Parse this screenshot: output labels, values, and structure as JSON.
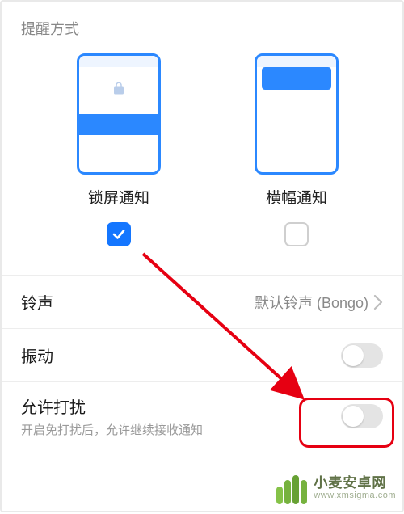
{
  "section_title": "提醒方式",
  "options": {
    "lockscreen": {
      "label": "锁屏通知",
      "checked": true
    },
    "banner": {
      "label": "横幅通知",
      "checked": false
    }
  },
  "rows": {
    "ringtone": {
      "title": "铃声",
      "value": "默认铃声 (Bongo)"
    },
    "vibrate": {
      "title": "振动",
      "on": false
    },
    "interrupt": {
      "title": "允许打扰",
      "subtitle": "开启免打扰后，允许继续接收通知",
      "on": false
    }
  },
  "watermark": {
    "title": "小麦安卓网",
    "url": "www.xmsigma.com"
  },
  "colors": {
    "accent": "#1476ff",
    "arrow": "#e60012"
  }
}
